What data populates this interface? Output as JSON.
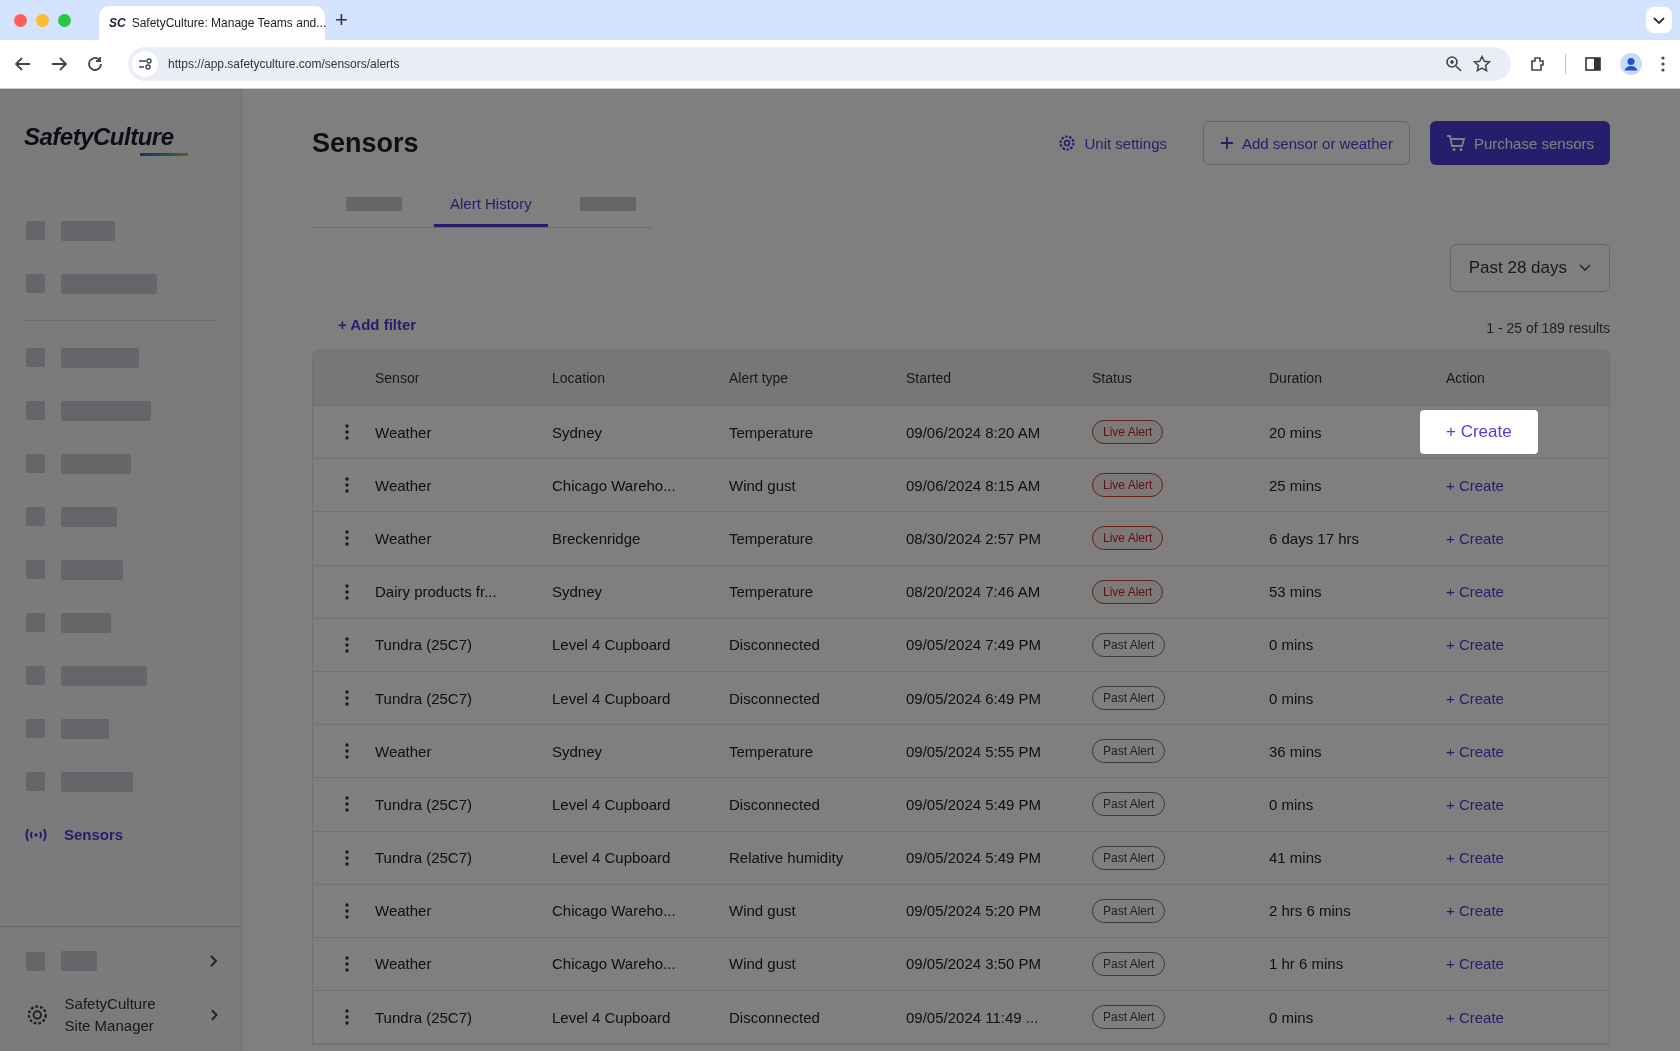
{
  "browser": {
    "favicon": "SC",
    "tab_title": "SafetyCulture: Manage Teams and...",
    "new_tab": "+",
    "url": "https://app.safetyculture.com/sensors/alerts"
  },
  "sidebar": {
    "logo": "SafetyCulture",
    "top_items": [
      {
        "kind": "redacted"
      },
      {
        "kind": "redacted"
      }
    ],
    "items": [
      {
        "kind": "redacted",
        "selected": false
      },
      {
        "kind": "redacted",
        "selected": false
      },
      {
        "kind": "redacted",
        "selected": false
      },
      {
        "kind": "redacted",
        "selected": false
      },
      {
        "kind": "redacted",
        "selected": false
      },
      {
        "kind": "redacted",
        "selected": false
      },
      {
        "kind": "redacted",
        "selected": false
      },
      {
        "kind": "redacted",
        "selected": false
      },
      {
        "kind": "redacted",
        "selected": false
      },
      {
        "kind": "link",
        "label": "Sensors",
        "selected": true
      }
    ],
    "footer_items": [
      {
        "kind": "redacted"
      },
      {
        "kind": "link",
        "label": "SafetyCulture Site Manager"
      }
    ]
  },
  "header": {
    "title": "Sensors",
    "actions": [
      {
        "kind": "link",
        "label": "Unit settings"
      },
      {
        "kind": "outline",
        "label": "Add sensor or weather"
      },
      {
        "kind": "primary",
        "label": "Purchase sensors"
      }
    ]
  },
  "tabs": [
    {
      "kind": "redacted",
      "selected": false
    },
    {
      "kind": "label",
      "label": "Alert History",
      "selected": true
    },
    {
      "kind": "redacted",
      "selected": false
    }
  ],
  "date_filter": "Past 28 days",
  "add_filter": "+ Add filter",
  "results": "1 - 25 of 189 results",
  "table": {
    "columns": [
      "Sensor",
      "Location",
      "Alert type",
      "Started",
      "Status",
      "Duration",
      "Action"
    ],
    "rows": [
      {
        "sensor": "Weather",
        "location": "Sydney",
        "alert_type": "Temperature",
        "started": "09/06/2024 8:20 AM",
        "status": {
          "kind": "live",
          "label": "Live Alert"
        },
        "duration": "20 mins",
        "action": {
          "label": "+ Create",
          "highlighted": true
        }
      },
      {
        "sensor": "Weather",
        "location": "Chicago Wareho...",
        "alert_type": "Wind gust",
        "started": "09/06/2024 8:15 AM",
        "status": {
          "kind": "live",
          "label": "Live Alert"
        },
        "duration": "25 mins",
        "action": {
          "label": "+ Create",
          "highlighted": false
        }
      },
      {
        "sensor": "Weather",
        "location": "Breckenridge",
        "alert_type": "Temperature",
        "started": "08/30/2024 2:57 PM",
        "status": {
          "kind": "live",
          "label": "Live Alert"
        },
        "duration": "6 days 17 hrs",
        "action": {
          "label": "+ Create",
          "highlighted": false
        }
      },
      {
        "sensor": "Dairy products fr...",
        "location": "Sydney",
        "alert_type": "Temperature",
        "started": "08/20/2024 7:46 AM",
        "status": {
          "kind": "live",
          "label": "Live Alert"
        },
        "duration": "53 mins",
        "action": {
          "label": "+ Create",
          "highlighted": false
        }
      },
      {
        "sensor": "Tundra (25C7)",
        "location": "Level 4 Cupboard",
        "alert_type": "Disconnected",
        "started": "09/05/2024 7:49 PM",
        "status": {
          "kind": "past",
          "label": "Past Alert"
        },
        "duration": "0 mins",
        "action": {
          "label": "+ Create",
          "highlighted": false
        }
      },
      {
        "sensor": "Tundra (25C7)",
        "location": "Level 4 Cupboard",
        "alert_type": "Disconnected",
        "started": "09/05/2024 6:49 PM",
        "status": {
          "kind": "past",
          "label": "Past Alert"
        },
        "duration": "0 mins",
        "action": {
          "label": "+ Create",
          "highlighted": false
        }
      },
      {
        "sensor": "Weather",
        "location": "Sydney",
        "alert_type": "Temperature",
        "started": "09/05/2024 5:55 PM",
        "status": {
          "kind": "past",
          "label": "Past Alert"
        },
        "duration": "36 mins",
        "action": {
          "label": "+ Create",
          "highlighted": false
        }
      },
      {
        "sensor": "Tundra (25C7)",
        "location": "Level 4 Cupboard",
        "alert_type": "Disconnected",
        "started": "09/05/2024 5:49 PM",
        "status": {
          "kind": "past",
          "label": "Past Alert"
        },
        "duration": "0 mins",
        "action": {
          "label": "+ Create",
          "highlighted": false
        }
      },
      {
        "sensor": "Tundra (25C7)",
        "location": "Level 4 Cupboard",
        "alert_type": "Relative humidity",
        "started": "09/05/2024 5:49 PM",
        "status": {
          "kind": "past",
          "label": "Past Alert"
        },
        "duration": "41 mins",
        "action": {
          "label": "+ Create",
          "highlighted": false
        }
      },
      {
        "sensor": "Weather",
        "location": "Chicago Wareho...",
        "alert_type": "Wind gust",
        "started": "09/05/2024 5:20 PM",
        "status": {
          "kind": "past",
          "label": "Past Alert"
        },
        "duration": "2 hrs 6 mins",
        "action": {
          "label": "+ Create",
          "highlighted": false
        }
      },
      {
        "sensor": "Weather",
        "location": "Chicago Wareho...",
        "alert_type": "Wind gust",
        "started": "09/05/2024 3:50 PM",
        "status": {
          "kind": "past",
          "label": "Past Alert"
        },
        "duration": "1 hr 6 mins",
        "action": {
          "label": "+ Create",
          "highlighted": false
        }
      },
      {
        "sensor": "Tundra (25C7)",
        "location": "Level 4 Cupboard",
        "alert_type": "Disconnected",
        "started": "09/05/2024 11:49 ...",
        "status": {
          "kind": "past",
          "label": "Past Alert"
        },
        "duration": "0 mins",
        "action": {
          "label": "+ Create",
          "highlighted": false
        }
      }
    ]
  }
}
